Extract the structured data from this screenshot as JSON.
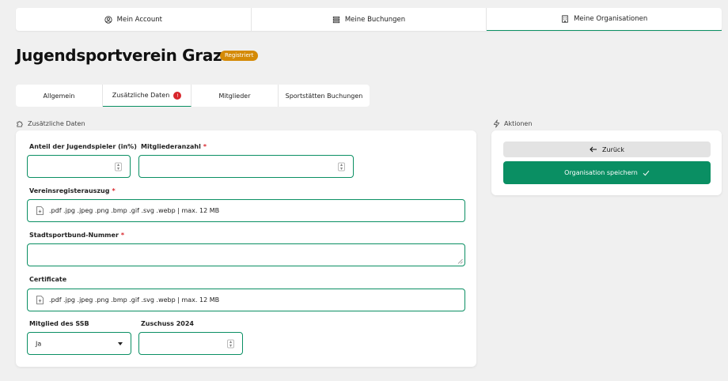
{
  "topnav": {
    "items": [
      {
        "label": "Mein Account",
        "icon": "user-circle-icon"
      },
      {
        "label": "Meine Buchungen",
        "icon": "list-icon"
      },
      {
        "label": "Meine Organisationen",
        "icon": "building-icon",
        "active": true
      }
    ]
  },
  "page": {
    "title": "Jugendsportverein Graz",
    "status": "Registriert"
  },
  "tabs": [
    {
      "label": "Allgemein"
    },
    {
      "label": "Zusätzliche Daten",
      "badge": "!",
      "active": true
    },
    {
      "label": "Mitglieder"
    },
    {
      "label": "Sportstätten Buchungen"
    }
  ],
  "form_section": {
    "title": "Zusätzliche Daten",
    "icon": "puzzle-icon",
    "fields": {
      "youth_share": {
        "label": "Anteil der Jugendspieler (in%)",
        "value": ""
      },
      "member_count": {
        "label": "Mitgliederanzahl",
        "required": "*",
        "value": ""
      },
      "register_extract": {
        "label": "Vereinsregisterauszug",
        "required": "*",
        "hint": ".pdf .jpg .jpeg .png .bmp .gif .svg .webp | max. 12 MB"
      },
      "sportbund_number": {
        "label": "Stadtsportbund-Nummer",
        "required": "*",
        "value": ""
      },
      "certificate": {
        "label": "Certificate",
        "hint": ".pdf .jpg .jpeg .png .bmp .gif .svg .webp | max. 12 MB"
      },
      "ssb_member": {
        "label": "Mitglied des SSB",
        "value": "Ja"
      },
      "grant_2024": {
        "label": "Zuschuss 2024",
        "value": ""
      }
    }
  },
  "actions_section": {
    "title": "Aktionen",
    "icon": "lightning-icon",
    "back_label": "Zurück",
    "save_label": "Organisation speichern"
  },
  "colors": {
    "accent": "#0a8f63",
    "badge": "#d48a06",
    "error": "#d8262c"
  }
}
